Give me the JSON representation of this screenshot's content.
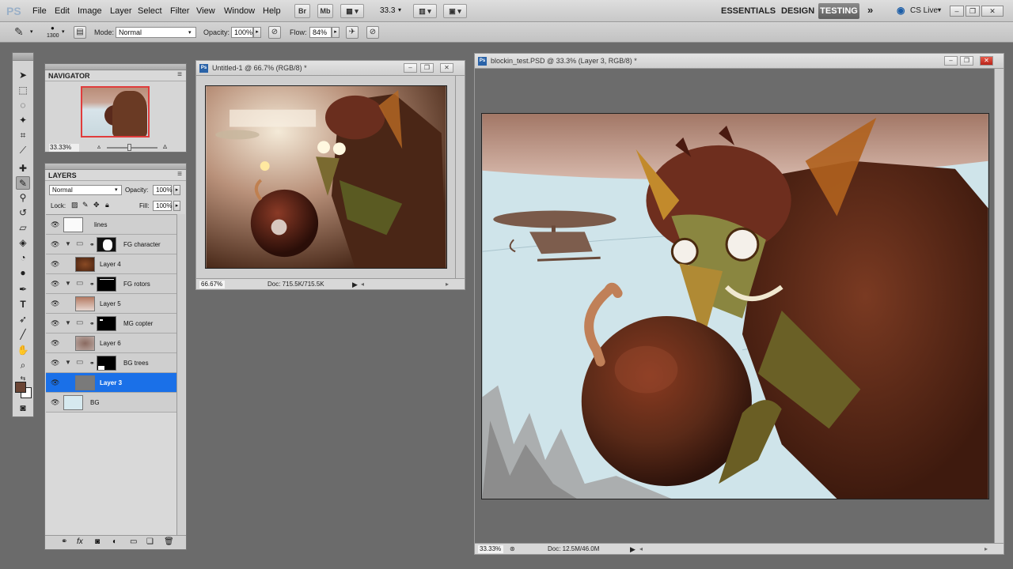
{
  "app": {
    "logo": "PS",
    "menu": [
      "File",
      "Edit",
      "Image",
      "Layer",
      "Select",
      "Filter",
      "View",
      "Window",
      "Help"
    ],
    "bridge_btn": "Br",
    "minibridge_btn": "Mb",
    "zoom_value": "33.3",
    "workspaces": [
      "ESSENTIALS",
      "DESIGN",
      "TESTING"
    ],
    "active_workspace": "TESTING",
    "cslive": "CS Live"
  },
  "options": {
    "brush_size": "1300",
    "mode_label": "Mode:",
    "mode_value": "Normal",
    "opacity_label": "Opacity:",
    "opacity_value": "100%",
    "flow_label": "Flow:",
    "flow_value": "84%"
  },
  "navigator": {
    "title": "NAVIGATOR",
    "zoom": "33.33%"
  },
  "layers_panel": {
    "title": "LAYERS",
    "blend_mode": "Normal",
    "opacity_label": "Opacity:",
    "opacity_value": "100%",
    "lock_label": "Lock:",
    "fill_label": "Fill:",
    "fill_value": "100%",
    "layers": [
      {
        "name": "lines",
        "group": false,
        "selected": false
      },
      {
        "name": "FG character",
        "group": true,
        "selected": false
      },
      {
        "name": "Layer 4",
        "group": false,
        "selected": false
      },
      {
        "name": "FG rotors",
        "group": true,
        "selected": false
      },
      {
        "name": "Layer 5",
        "group": false,
        "selected": false
      },
      {
        "name": "MG copter",
        "group": true,
        "selected": false
      },
      {
        "name": "Layer 6",
        "group": false,
        "selected": false
      },
      {
        "name": "BG trees",
        "group": true,
        "selected": false
      },
      {
        "name": "Layer 3",
        "group": false,
        "selected": true
      },
      {
        "name": "BG",
        "group": false,
        "selected": false
      }
    ]
  },
  "doc1": {
    "title": "Untitled-1 @ 66.7% (RGB/8) *",
    "zoom": "66.67%",
    "doc_size": "Doc: 715.5K/715.5K"
  },
  "doc2": {
    "title": "blockin_test.PSD @ 33.3% (Layer 3, RGB/8) *",
    "zoom": "33.33%",
    "doc_size": "Doc: 12.5M/46.0M"
  },
  "colors": {
    "selection_blue": "#1a70e8",
    "foreground_swatch": "#6b4535",
    "sky": "#cfe4ea"
  }
}
